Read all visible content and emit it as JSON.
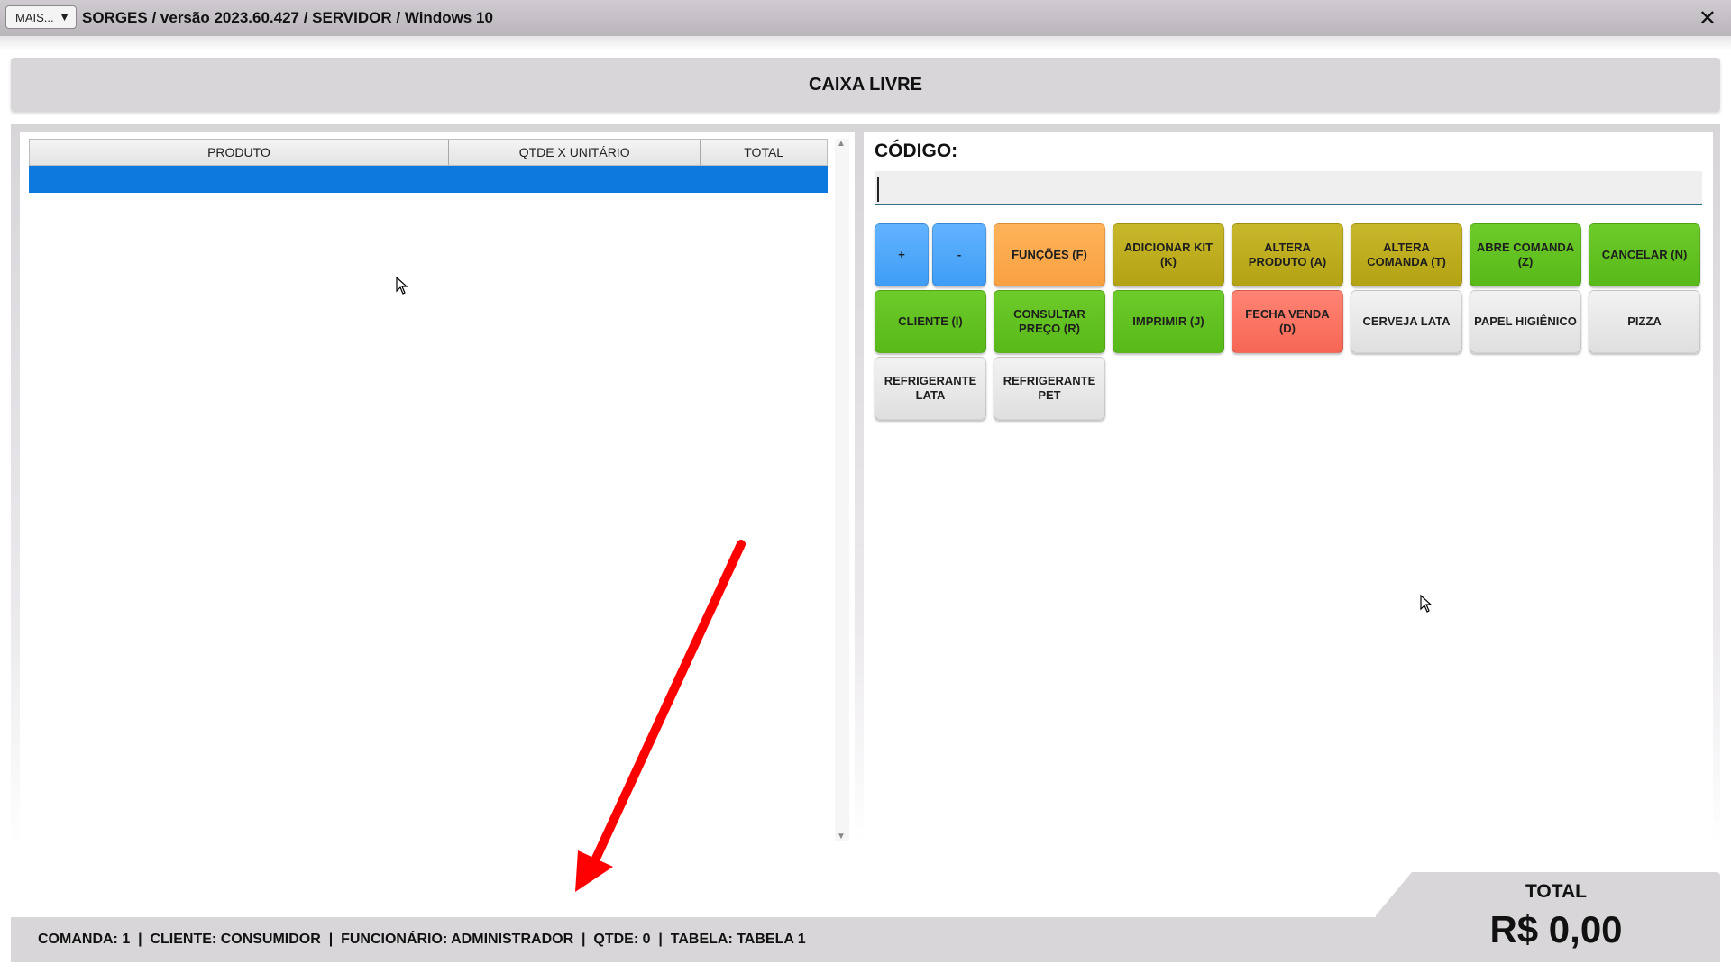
{
  "window": {
    "menu_button_label": "MAIS...",
    "menu_button_arrow": "▼",
    "title": "SORGES / versão 2023.60.427 / SERVIDOR / Windows 10",
    "close_glyph": "✕"
  },
  "status": {
    "caixa": "CAIXA LIVRE"
  },
  "grid": {
    "columns": [
      "PRODUTO",
      "QTDE X UNITÁRIO",
      "TOTAL"
    ],
    "rows": [],
    "scroll_up": "▲",
    "scroll_down": "▼"
  },
  "codigo": {
    "label": "CÓDIGO:",
    "value": ""
  },
  "buttons": [
    {
      "label": "+",
      "color": "blue"
    },
    {
      "label": "-",
      "color": "blue"
    },
    {
      "label": "FUNÇÕES (F)",
      "color": "orange"
    },
    {
      "label": "ADICIONAR KIT (K)",
      "color": "olive"
    },
    {
      "label": "ALTERA PRODUTO (A)",
      "color": "olive"
    },
    {
      "label": "ALTERA COMANDA (T)",
      "color": "olive"
    },
    {
      "label": "ABRE COMANDA (Z)",
      "color": "green"
    },
    {
      "label": "CANCELAR (N)",
      "color": "green"
    },
    {
      "label": "CLIENTE (I)",
      "color": "green"
    },
    {
      "label": "CONSULTAR PREÇO (R)",
      "color": "green"
    },
    {
      "label": "IMPRIMIR (J)",
      "color": "green"
    },
    {
      "label": "FECHA VENDA (D)",
      "color": "red"
    },
    {
      "label": "CERVEJA LATA",
      "color": "gray"
    },
    {
      "label": "PAPEL HIGIÊNICO",
      "color": "gray"
    },
    {
      "label": "PIZZA",
      "color": "gray"
    },
    {
      "label": "REFRIGERANTE LATA",
      "color": "gray"
    },
    {
      "label": "REFRIGERANTE PET",
      "color": "gray"
    }
  ],
  "footer": {
    "info": "COMANDA: 1  |  CLIENTE: CONSUMIDOR  |  FUNCIONÁRIO: ADMINISTRADOR  |  QTDE: 0  |  TABELA: TABELA 1",
    "total_label": "TOTAL",
    "total_value": "R$ 0,00"
  },
  "colors": {
    "selected_row": "#0b79dd",
    "arrow": "#ff0000"
  }
}
